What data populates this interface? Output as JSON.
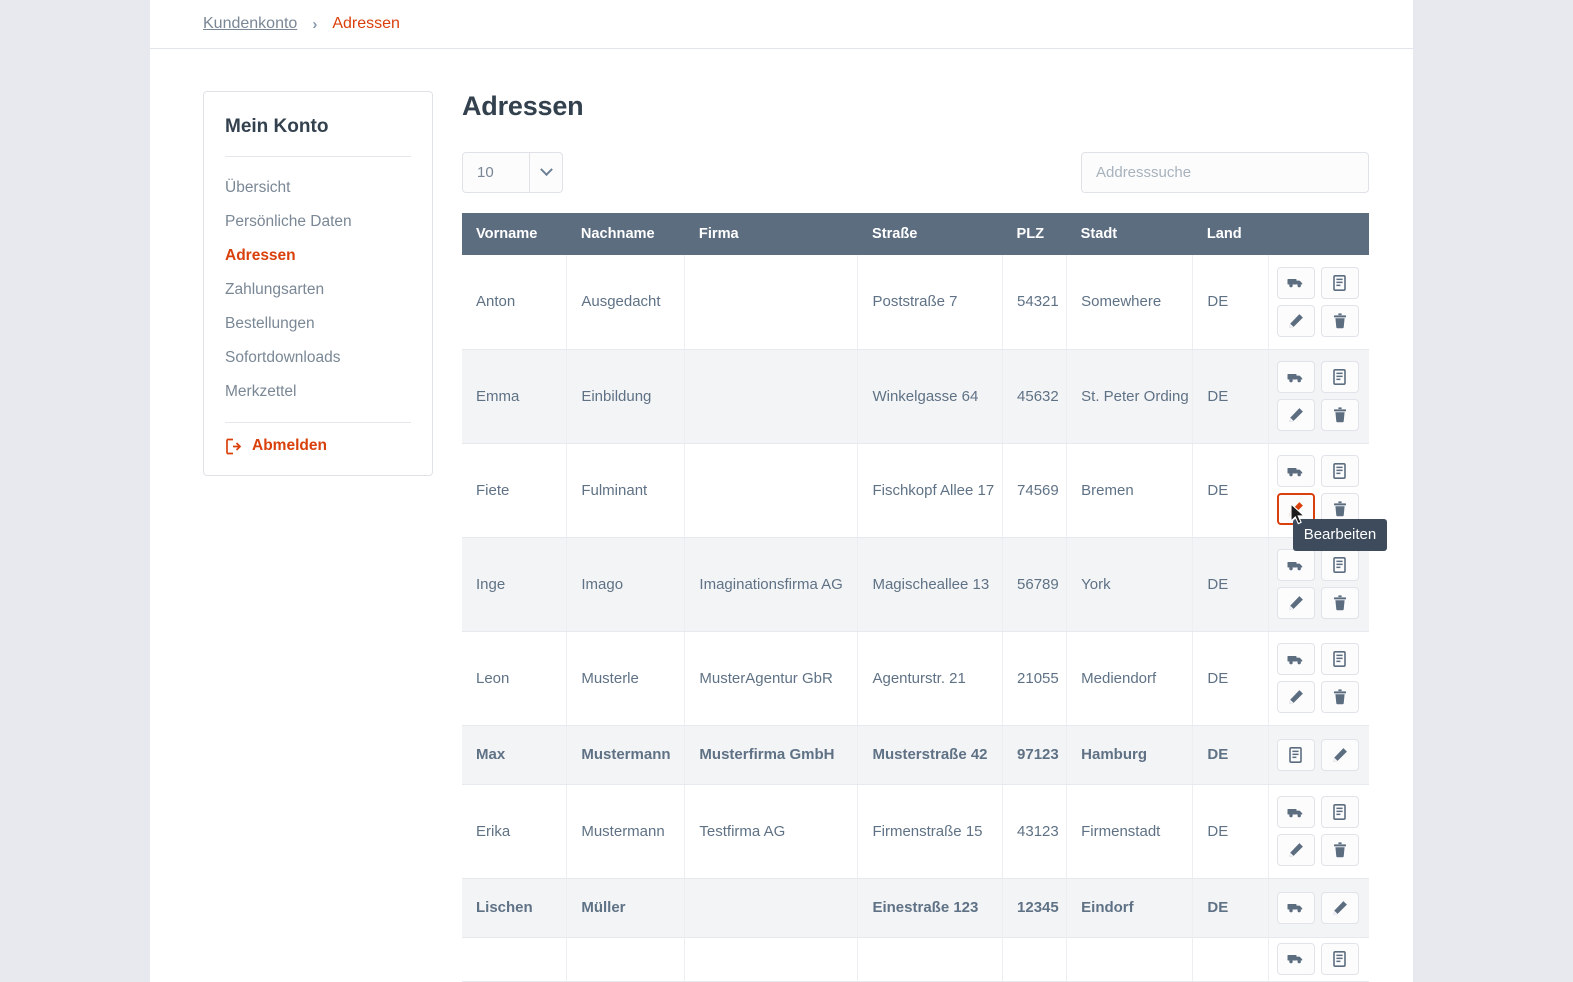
{
  "breadcrumb": {
    "root": "Kundenkonto",
    "separator": "›",
    "current": "Adressen"
  },
  "sidebar": {
    "title": "Mein Konto",
    "items": [
      {
        "label": "Übersicht",
        "active": false
      },
      {
        "label": "Persönliche Daten",
        "active": false
      },
      {
        "label": "Adressen",
        "active": true
      },
      {
        "label": "Zahlungsarten",
        "active": false
      },
      {
        "label": "Bestellungen",
        "active": false
      },
      {
        "label": "Sofortdownloads",
        "active": false
      },
      {
        "label": "Merkzettel",
        "active": false
      }
    ],
    "logout_label": "Abmelden"
  },
  "main": {
    "page_title": "Adressen",
    "per_page_value": "10",
    "search_placeholder": "Addresssuche",
    "columns": [
      "Vorname",
      "Nachname",
      "Firma",
      "Straße",
      "PLZ",
      "Stadt",
      "Land"
    ],
    "rows": [
      {
        "vorname": "Anton",
        "nachname": "Ausgedacht",
        "firma": "",
        "strasse": "Poststraße 7",
        "plz": "54321",
        "stadt": "Somewhere",
        "land": "DE",
        "actions": [
          "truck",
          "doc",
          "pencil",
          "trash"
        ],
        "bold": false,
        "alt": false,
        "height": "tall"
      },
      {
        "vorname": "Emma",
        "nachname": "Einbildung",
        "firma": "",
        "strasse": "Winkelgasse 64",
        "plz": "45632",
        "stadt": "St. Peter Ording",
        "land": "DE",
        "actions": [
          "truck",
          "doc",
          "pencil",
          "trash"
        ],
        "bold": false,
        "alt": true,
        "height": "tall"
      },
      {
        "vorname": "Fiete",
        "nachname": "Fulminant",
        "firma": "",
        "strasse": "Fischkopf Allee 17",
        "plz": "74569",
        "stadt": "Bremen",
        "land": "DE",
        "actions": [
          "truck",
          "doc",
          "pencil-active",
          "trash"
        ],
        "bold": false,
        "alt": false,
        "height": "tall"
      },
      {
        "vorname": "Inge",
        "nachname": "Imago",
        "firma": "Imaginationsfirma AG",
        "strasse": "Magischeallee 13",
        "plz": "56789",
        "stadt": "York",
        "land": "DE",
        "actions": [
          "truck",
          "doc",
          "pencil",
          "trash"
        ],
        "bold": false,
        "alt": true,
        "height": "tall"
      },
      {
        "vorname": "Leon",
        "nachname": "Musterle",
        "firma": "MusterAgentur GbR",
        "strasse": "Agenturstr. 21",
        "plz": "21055",
        "stadt": "Mediendorf",
        "land": "DE",
        "actions": [
          "truck",
          "doc",
          "pencil",
          "trash"
        ],
        "bold": false,
        "alt": false,
        "height": "tall"
      },
      {
        "vorname": "Max",
        "nachname": "Mustermann",
        "firma": "Musterfirma GmbH",
        "strasse": "Musterstraße 42",
        "plz": "97123",
        "stadt": "Hamburg",
        "land": "DE",
        "actions": [
          "doc",
          "pencil"
        ],
        "bold": true,
        "alt": true,
        "height": "short"
      },
      {
        "vorname": "Erika",
        "nachname": "Mustermann",
        "firma": "Testfirma AG",
        "strasse": "Firmenstraße 15",
        "plz": "43123",
        "stadt": "Firmenstadt",
        "land": "DE",
        "actions": [
          "truck",
          "doc",
          "pencil",
          "trash"
        ],
        "bold": false,
        "alt": false,
        "height": "tall"
      },
      {
        "vorname": "Lischen",
        "nachname": "Müller",
        "firma": "",
        "strasse": "Einestraße 123",
        "plz": "12345",
        "stadt": "Eindorf",
        "land": "DE",
        "actions": [
          "truck",
          "pencil"
        ],
        "bold": true,
        "alt": true,
        "height": "short"
      }
    ],
    "tooltip": {
      "text": "Bearbeiten"
    }
  },
  "colors": {
    "accent": "#d9400b",
    "table_header_bg": "#5c6d80",
    "tooltip_bg": "#3d4b5c",
    "page_bg": "#e8e9ef",
    "text": "#5f7285"
  },
  "icons": {
    "truck": "truck-icon",
    "doc": "document-icon",
    "pencil": "pencil-icon",
    "trash": "trash-icon",
    "logout": "logout-icon",
    "chevron": "chevron-down-icon"
  }
}
